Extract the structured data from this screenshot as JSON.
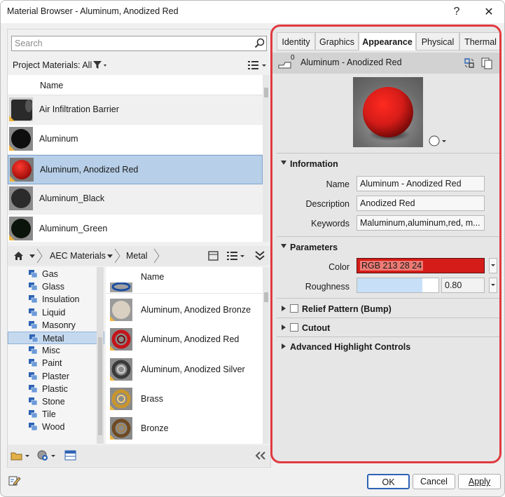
{
  "window": {
    "title": "Material Browser - Aluminum, Anodized Red",
    "help_label": "?",
    "close_label": "✕"
  },
  "search": {
    "placeholder": "Search",
    "value": ""
  },
  "project_materials": {
    "label": "Project Materials: All",
    "column_header": "Name",
    "items": [
      {
        "label": "Air Infiltration Barrier",
        "thumb": "dark-cylinder",
        "selected": false
      },
      {
        "label": "Aluminum",
        "thumb": "black-sphere",
        "selected": false
      },
      {
        "label": "Aluminum, Anodized Red",
        "thumb": "red-sphere",
        "selected": true
      },
      {
        "label": "Aluminum_Black",
        "thumb": "black-sphere",
        "selected": false
      },
      {
        "label": "Aluminum_Green",
        "thumb": "dark-green-sphere",
        "selected": false
      }
    ]
  },
  "breadcrumb": {
    "items": [
      "AEC Materials",
      "Metal"
    ]
  },
  "library_tree": {
    "items": [
      {
        "label": "Gas",
        "selected": false
      },
      {
        "label": "Glass",
        "selected": false
      },
      {
        "label": "Insulation",
        "selected": false
      },
      {
        "label": "Liquid",
        "selected": false
      },
      {
        "label": "Masonry",
        "selected": false
      },
      {
        "label": "Metal",
        "selected": true
      },
      {
        "label": "Misc",
        "selected": false
      },
      {
        "label": "Paint",
        "selected": false
      },
      {
        "label": "Plaster",
        "selected": false
      },
      {
        "label": "Plastic",
        "selected": false
      },
      {
        "label": "Stone",
        "selected": false
      },
      {
        "label": "Tile",
        "selected": false
      },
      {
        "label": "Wood",
        "selected": false
      }
    ]
  },
  "library_list": {
    "column_header": "Name",
    "items": [
      {
        "label": "Aluminum, Anodized Bronze",
        "thumb": "beige-sphere"
      },
      {
        "label": "Aluminum, Anodized Red",
        "thumb": "red-ring"
      },
      {
        "label": "Aluminum, Anodized Silver",
        "thumb": "silver-ring"
      },
      {
        "label": "Brass",
        "thumb": "gold-ring"
      },
      {
        "label": "Bronze",
        "thumb": "bronze-ring"
      }
    ]
  },
  "tabs": [
    {
      "label": "Identity",
      "active": false
    },
    {
      "label": "Graphics",
      "active": false
    },
    {
      "label": "Appearance",
      "active": true
    },
    {
      "label": "Physical",
      "active": false
    },
    {
      "label": "Thermal",
      "active": false
    }
  ],
  "asset": {
    "count": "0",
    "name": "Aluminum - Anodized Red"
  },
  "information": {
    "title": "Information",
    "name_label": "Name",
    "name_value": "Aluminum - Anodized Red",
    "description_label": "Description",
    "description_value": "Anodized Red",
    "keywords_label": "Keywords",
    "keywords_value": "Maluminum,aluminum,red, m..."
  },
  "parameters": {
    "title": "Parameters",
    "color_label": "Color",
    "color_value": "RGB 213 28 24",
    "color_hex": "#d51c18",
    "roughness_label": "Roughness",
    "roughness_value": "0.80",
    "roughness_fraction": 0.8
  },
  "collapsed_sections": [
    {
      "label": "Relief Pattern (Bump)",
      "checkbox": true,
      "checked": false
    },
    {
      "label": "Cutout",
      "checkbox": true,
      "checked": false
    },
    {
      "label": "Advanced Highlight Controls",
      "checkbox": false,
      "checked": false
    }
  ],
  "footer": {
    "ok_label": "OK",
    "cancel_label": "Cancel",
    "apply_label": "Apply"
  },
  "colors": {
    "highlight_border": "#e03a3f",
    "selection": "#b7cfe8",
    "accent_blue": "#2d63b5"
  }
}
